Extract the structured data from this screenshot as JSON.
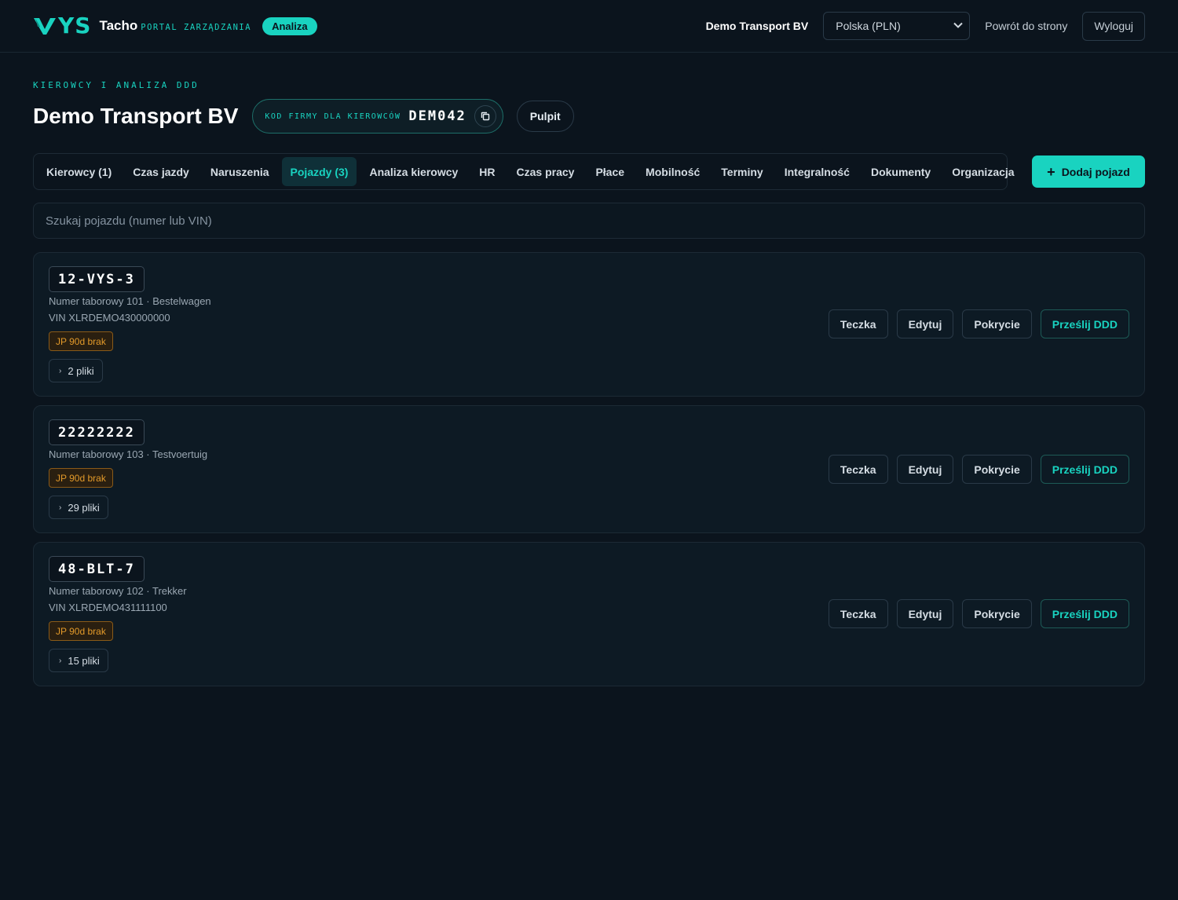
{
  "header": {
    "logo_ys": "YS",
    "logo_tacho": "Tacho",
    "logo_sub": "PORTAL ZARZĄDZANIA",
    "mode_badge": "Analiza",
    "company": "Demo Transport BV",
    "country_select": "Polska (PLN)",
    "back_link": "Powrót do strony",
    "logout": "Wyloguj"
  },
  "page": {
    "eyebrow": "KIEROWCY I ANALIZA DDD",
    "title": "Demo Transport BV",
    "code_label": "KOD FIRMY DLA KIEROWCÓW",
    "code_value": "DEM042",
    "pulpit": "Pulpit"
  },
  "tabs": [
    {
      "label": "Kierowcy (1)",
      "active": false
    },
    {
      "label": "Czas jazdy",
      "active": false
    },
    {
      "label": "Naruszenia",
      "active": false
    },
    {
      "label": "Pojazdy (3)",
      "active": true
    },
    {
      "label": "Analiza kierowcy",
      "active": false
    },
    {
      "label": "HR",
      "active": false
    },
    {
      "label": "Czas pracy",
      "active": false
    },
    {
      "label": "Płace",
      "active": false
    },
    {
      "label": "Mobilność",
      "active": false
    },
    {
      "label": "Terminy",
      "active": false
    },
    {
      "label": "Integralność",
      "active": false
    },
    {
      "label": "Dokumenty",
      "active": false
    },
    {
      "label": "Organizacja",
      "active": false
    }
  ],
  "add_vehicle": "Dodaj pojazd",
  "search": {
    "placeholder": "Szukaj pojazdu (numer lub VIN)",
    "value": ""
  },
  "actions": {
    "folder": "Teczka",
    "edit": "Edytuj",
    "coverage": "Pokrycie",
    "upload": "Prześlij DDD"
  },
  "vehicles": [
    {
      "plate": "12-VYS-3",
      "meta": "Numer taborowy 101 · Bestelwagen",
      "vin": "VIN XLRDEMO430000000",
      "badge": "JP 90d brak",
      "files": "2 pliki"
    },
    {
      "plate": "22222222",
      "meta": "Numer taborowy 103 · Testvoertuig",
      "vin": "",
      "badge": "JP 90d brak",
      "files": "29 pliki"
    },
    {
      "plate": "48-BLT-7",
      "meta": "Numer taborowy 102 · Trekker",
      "vin": "VIN XLRDEMO431111100",
      "badge": "JP 90d brak",
      "files": "15 pliki"
    }
  ],
  "colors": {
    "accent": "#19d3c0",
    "background": "#0b141d",
    "warning": "#e39a2a"
  }
}
